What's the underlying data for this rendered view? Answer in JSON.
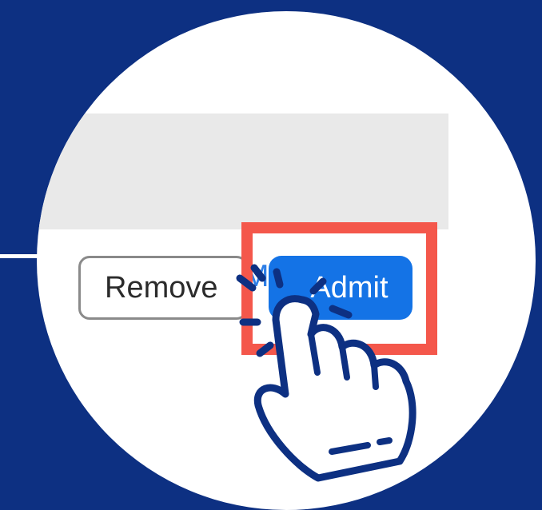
{
  "panel": {
    "message_label": "Message",
    "remove_label": "Remove",
    "admit_label": "Admit"
  },
  "colors": {
    "background": "#0d3082",
    "admit_button": "#1473e6",
    "message_link": "#2d7ee6",
    "highlight": "#f4574b"
  },
  "icons": {
    "pointer": "hand-pointer-click-icon"
  }
}
